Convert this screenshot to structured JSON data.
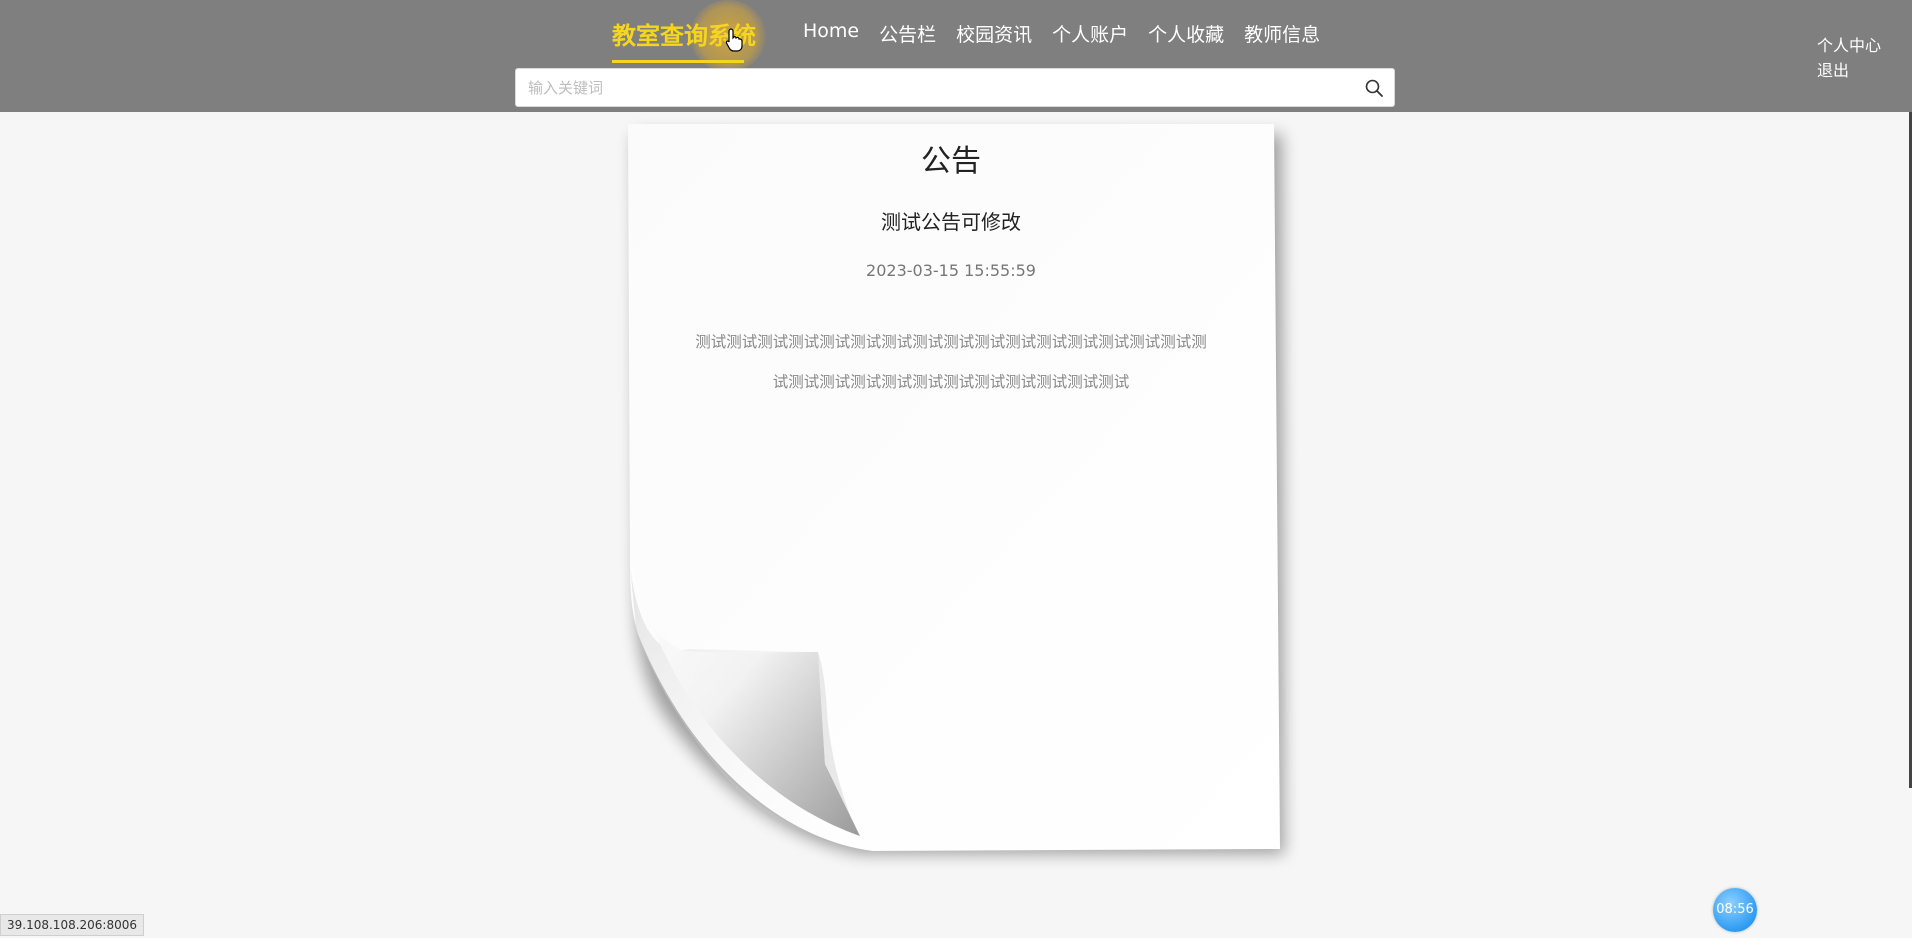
{
  "header": {
    "brand": "教室查询系统",
    "nav": [
      "Home",
      "公告栏",
      "校园资讯",
      "个人账户",
      "个人收藏",
      "教师信息"
    ],
    "user_center": "个人中心",
    "logout": "退出",
    "search_placeholder": "输入关键词"
  },
  "notice": {
    "section_title": "公告",
    "title": "测试公告可修改",
    "date": "2023-03-15 15:55:59",
    "body": "测试测试测试测试测试测试测试测试测试测试测试测试测试测试测试测试测试测试测试测试测试测试测试测试测试测试测试测试"
  },
  "status": {
    "url": "39.108.108.206:8006",
    "clock": "08:56"
  },
  "colors": {
    "header_bg": "#7f7f7f",
    "brand": "#f6d51f",
    "page_bg": "#f6f6f6"
  }
}
